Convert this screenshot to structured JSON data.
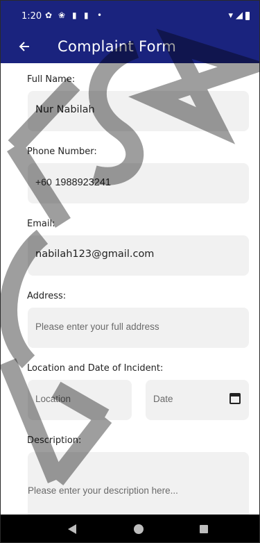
{
  "status_bar": {
    "time": "1:20",
    "icons": [
      "settings-icon",
      "fan-icon",
      "sim-icon",
      "sim-icon",
      "dot-icon",
      "wifi-icon",
      "signal-icon",
      "battery-icon"
    ]
  },
  "app_bar": {
    "title": "Complaint Form",
    "back_icon": "arrow-left-icon",
    "color": "#1a237e"
  },
  "form": {
    "full_name": {
      "label": "Full Name:",
      "value": "Nur Nabilah"
    },
    "phone": {
      "label": "Phone Number:",
      "prefix": "+60",
      "value": "1988923241"
    },
    "email": {
      "label": "Email:",
      "value": "nabilah123@gmail.com"
    },
    "address": {
      "label": "Address:",
      "placeholder": "Please enter your full address"
    },
    "location_date": {
      "label": "Location and Date of Incident:",
      "location_placeholder": "Location",
      "date_placeholder": "Date",
      "date_icon": "calendar-icon"
    },
    "description": {
      "label": "Description:",
      "placeholder": "Please enter your description here..."
    }
  },
  "nav_bar": {
    "icons": [
      "nav-back-icon",
      "nav-home-icon",
      "nav-recents-icon"
    ]
  }
}
